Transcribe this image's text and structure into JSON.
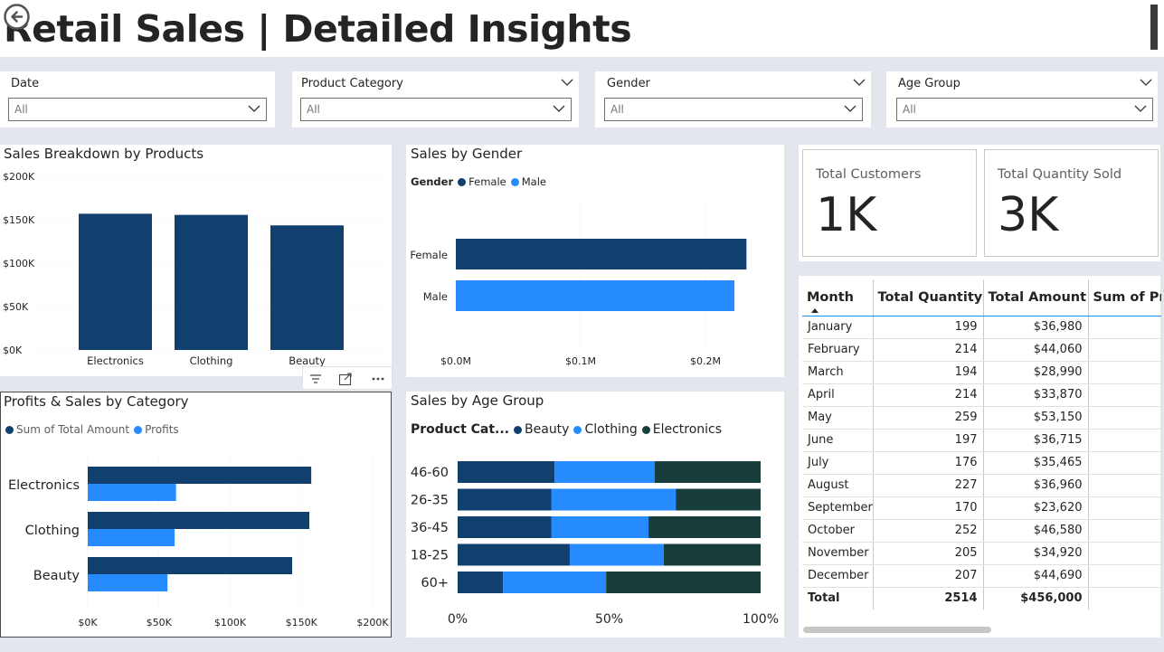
{
  "page": {
    "title": "Retail Sales | Detailed Insights"
  },
  "slicers": [
    {
      "label": "Date",
      "value": "All"
    },
    {
      "label": "Product Category",
      "value": "All"
    },
    {
      "label": "Gender",
      "value": "All"
    },
    {
      "label": "Age Group",
      "value": "All"
    }
  ],
  "cards": {
    "customers": {
      "label": "Total Customers",
      "value": "1K"
    },
    "quantity": {
      "label": "Total Quantity Sold",
      "value": "3K"
    }
  },
  "colors": {
    "dark_blue": "#12406E",
    "light_blue": "#258BFF",
    "dark_green": "#183E3C",
    "header_rule": "#118DFF"
  },
  "products_panel": {
    "title": "Sales Breakdown by Products"
  },
  "gender_panel": {
    "title": "Sales by Gender",
    "legend_title": "Gender",
    "legend": [
      "Female",
      "Male"
    ]
  },
  "profits_panel": {
    "title": "Profits & Sales by Category",
    "legend": [
      "Sum of Total Amount",
      "Profits"
    ]
  },
  "age_panel": {
    "title": "Sales by Age Group",
    "legend_title": "Product Cat...",
    "legend": [
      "Beauty",
      "Clothing",
      "Electronics"
    ]
  },
  "visual_header": {
    "icons": [
      "filter-icon",
      "focus-mode-icon",
      "more-options-icon"
    ]
  },
  "table": {
    "columns": [
      "Month",
      "Total Quantity",
      "Total Amount",
      "Sum of Pr"
    ],
    "rows": [
      [
        "January",
        "199",
        "$36,980"
      ],
      [
        "February",
        "214",
        "$44,060"
      ],
      [
        "March",
        "194",
        "$28,990"
      ],
      [
        "April",
        "214",
        "$33,870"
      ],
      [
        "May",
        "259",
        "$53,150"
      ],
      [
        "June",
        "197",
        "$36,715"
      ],
      [
        "July",
        "176",
        "$35,465"
      ],
      [
        "August",
        "227",
        "$36,960"
      ],
      [
        "September",
        "170",
        "$23,620"
      ],
      [
        "October",
        "252",
        "$46,580"
      ],
      [
        "November",
        "205",
        "$34,920"
      ],
      [
        "December",
        "207",
        "$44,690"
      ]
    ],
    "total": [
      "Total",
      "2514",
      "$456,000"
    ]
  },
  "chart_data": [
    {
      "id": "products",
      "type": "bar",
      "title": "Sales Breakdown by Products",
      "categories": [
        "Electronics",
        "Clothing",
        "Beauty"
      ],
      "values": [
        156905,
        155580,
        143515
      ],
      "ylim": [
        0,
        200000
      ],
      "yticks": [
        "$200K",
        "$150K",
        "$100K",
        "$50K",
        "$0K"
      ],
      "grid": true
    },
    {
      "id": "gender",
      "type": "bar",
      "orientation": "horizontal",
      "title": "Sales by Gender",
      "categories": [
        "Female",
        "Male"
      ],
      "values": [
        232840,
        223160
      ],
      "xlim": [
        0,
        250000
      ],
      "xticks": [
        "$0.0M",
        "$0.1M",
        "$0.2M"
      ],
      "legend": "top-left"
    },
    {
      "id": "profits",
      "type": "bar",
      "orientation": "horizontal",
      "title": "Profits & Sales by Category",
      "categories": [
        "Electronics",
        "Clothing",
        "Beauty"
      ],
      "series": [
        {
          "name": "Sum of Total Amount",
          "values": [
            156905,
            155580,
            143515
          ]
        },
        {
          "name": "Profits",
          "values": [
            62000,
            61000,
            56000
          ]
        }
      ],
      "xlim": [
        0,
        200000
      ],
      "xticks": [
        "$0K",
        "$50K",
        "$100K",
        "$150K",
        "$200K"
      ],
      "legend": "top-left"
    },
    {
      "id": "age",
      "type": "bar",
      "orientation": "horizontal",
      "stacked": "percent",
      "title": "Sales by Age Group",
      "categories": [
        "46-60",
        "26-35",
        "36-45",
        "18-25",
        "60+"
      ],
      "series": [
        {
          "name": "Beauty",
          "values": [
            32,
            31,
            31,
            37,
            15
          ]
        },
        {
          "name": "Clothing",
          "values": [
            33,
            41,
            32,
            31,
            34
          ]
        },
        {
          "name": "Electronics",
          "values": [
            35,
            28,
            37,
            32,
            51
          ]
        }
      ],
      "xticks": [
        "0%",
        "50%",
        "100%"
      ],
      "legend": "top-left"
    }
  ]
}
